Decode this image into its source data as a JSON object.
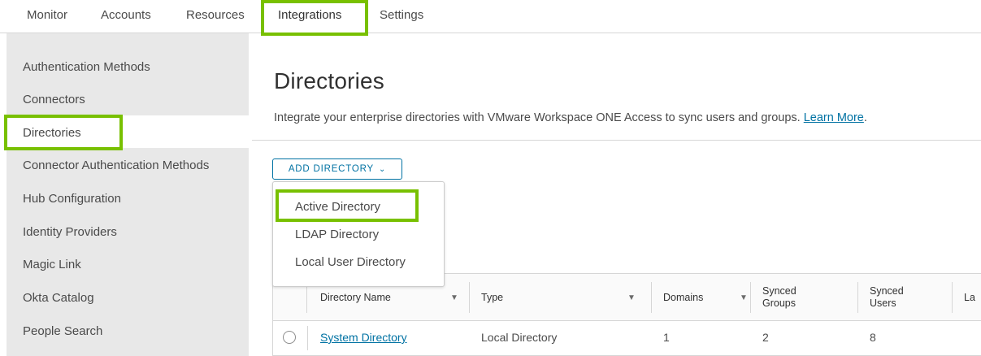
{
  "topnav": {
    "tabs": [
      "Monitor",
      "Accounts",
      "Resources",
      "Integrations",
      "Settings"
    ],
    "active": "Integrations"
  },
  "sidebar": {
    "items": [
      "Authentication Methods",
      "Connectors",
      "Directories",
      "Connector Authentication Methods",
      "Hub Configuration",
      "Identity Providers",
      "Magic Link",
      "Okta Catalog",
      "People Search"
    ],
    "selected": "Directories"
  },
  "main": {
    "title": "Directories",
    "description": "Integrate your enterprise directories with VMware Workspace ONE Access to sync users and groups.",
    "learn_more": "Learn More",
    "add_button": "ADD DIRECTORY",
    "dropdown": [
      "Active Directory",
      "LDAP Directory",
      "Local User Directory"
    ]
  },
  "table": {
    "columns": [
      "Directory Name",
      "Type",
      "Domains",
      "Synced Groups",
      "Synced Users",
      "La"
    ],
    "rows": [
      {
        "name": "System Directory",
        "type": "Local Directory",
        "domains": "1",
        "groups": "2",
        "users": "8"
      }
    ]
  },
  "colors": {
    "highlight": "#78c000",
    "link": "#0072a3",
    "sidebar_bg": "#e8e8e8"
  }
}
